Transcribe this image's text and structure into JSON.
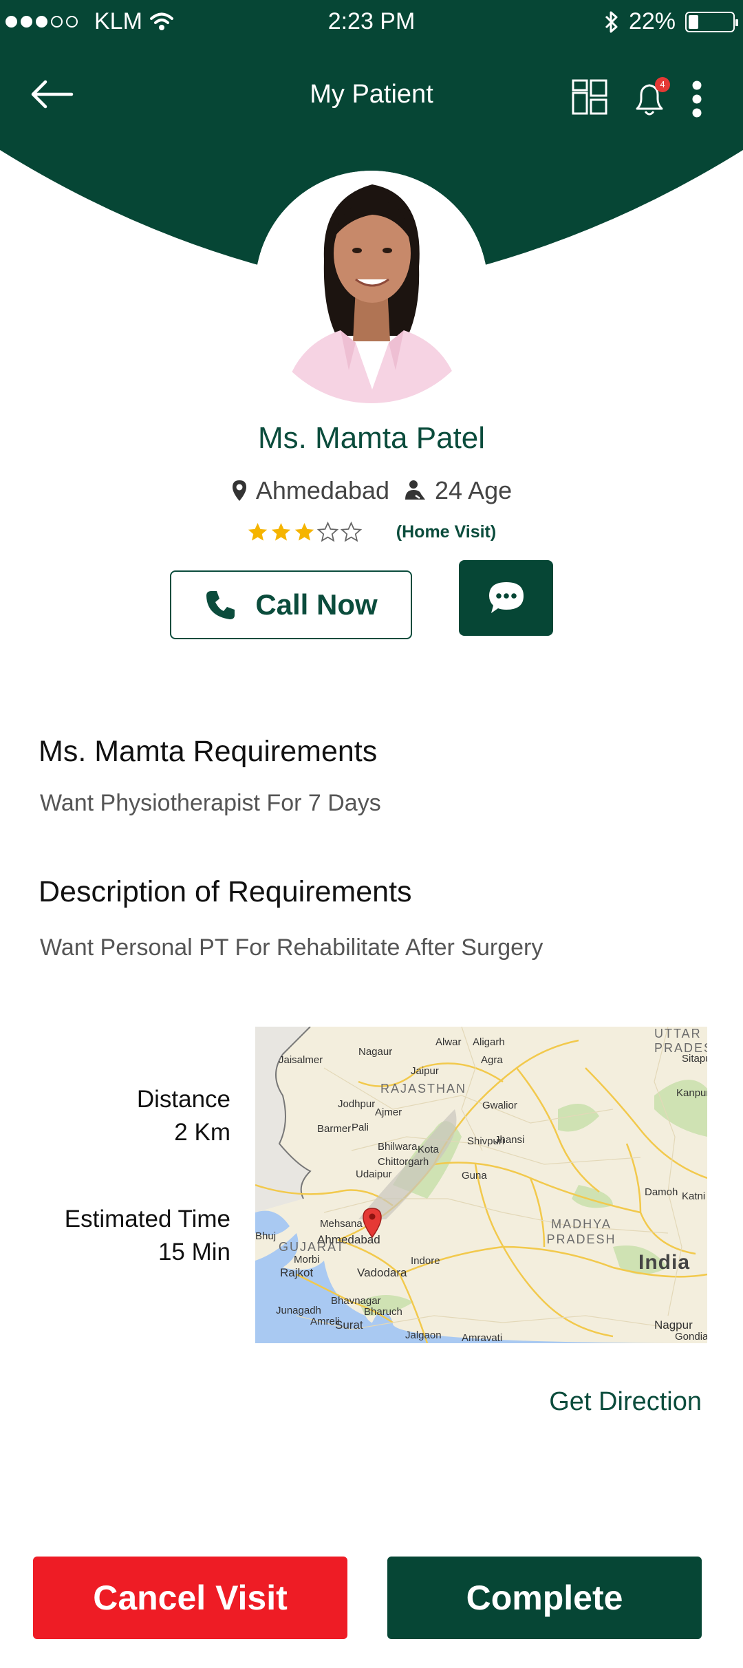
{
  "status_bar": {
    "carrier": "KLM",
    "time": "2:23 PM",
    "battery": "22%",
    "battery_level": 0.22,
    "icons": [
      "signal-dots-icon",
      "wifi-icon",
      "bluetooth-icon",
      "battery-icon"
    ]
  },
  "header": {
    "title": "My Patient",
    "notification_count": "4",
    "icons": [
      "back-arrow-icon",
      "grid-icon",
      "bell-icon",
      "more-vertical-icon"
    ]
  },
  "patient": {
    "name": "Ms. Mamta Patel",
    "location": "Ahmedabad",
    "age": "24 Age",
    "rating": 3,
    "rating_max": 5,
    "visit_type": "(Home Visit)"
  },
  "actions": {
    "call_label": "Call Now",
    "chat_icon": "chat-bubble-icon"
  },
  "requirements": {
    "title": "Ms. Mamta Requirements",
    "text": "Want Physiotherapist For 7 Days"
  },
  "description": {
    "title": "Description of Requirements",
    "text": "Want Personal PT For Rehabilitate After Surgery"
  },
  "trip": {
    "distance_label": "Distance",
    "distance_value": "2 Km",
    "time_label": "Estimated Time",
    "time_value": "15 Min"
  },
  "map": {
    "places": [
      "Jaisalmer",
      "Nagaur",
      "Alwar",
      "Aligarh",
      "Agra",
      "Jaipur",
      "Jodhpur",
      "Ajmer",
      "Gwalior",
      "Kanpur",
      "Barmer",
      "Pali",
      "Bhilwara",
      "Kota",
      "Shivpuri",
      "Jhansi",
      "Chittorgarh",
      "Udaipur",
      "Guna",
      "Damoh",
      "Mehsana",
      "Ahmedabad",
      "Bhuj",
      "Morbi",
      "Rajkot",
      "Vadodara",
      "Indore",
      "Bhavnagar",
      "Bharuch",
      "Junagadh",
      "Amreli",
      "Surat",
      "Jalgaon",
      "Amravati",
      "Nagpur",
      "Gondia",
      "Katni",
      "Sitapur"
    ],
    "regions": [
      "UTTAR PRADESH",
      "RAJASTHAN",
      "MADHYA PRADESH",
      "GUJARAT",
      "India"
    ],
    "marker": "map-pin-icon"
  },
  "get_direction": "Get Direction",
  "footer": {
    "cancel_label": "Cancel Visit",
    "complete_label": "Complete"
  },
  "colors": {
    "primary": "#064635",
    "accent_text": "#0b4c3c",
    "danger": "#ee1c25",
    "star": "#f5b400"
  }
}
